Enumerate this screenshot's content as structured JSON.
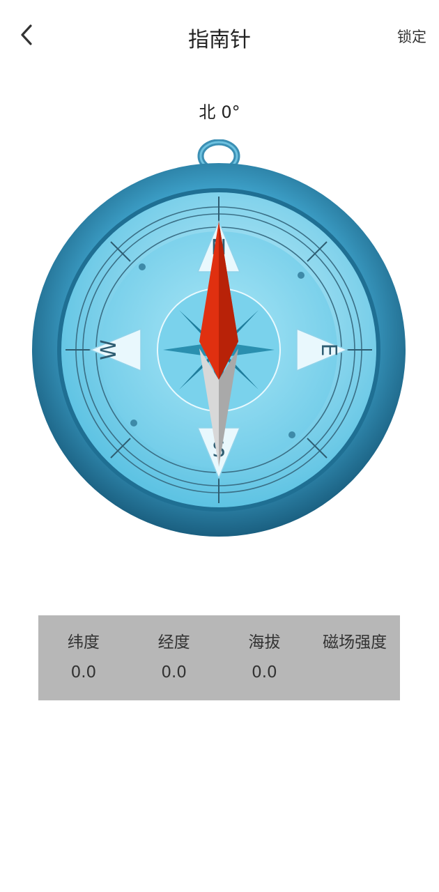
{
  "header": {
    "title": "指南针",
    "lock_label": "锁定"
  },
  "heading": {
    "direction": "北",
    "degrees": "0°"
  },
  "compass": {
    "north_label": "N",
    "south_label": "S",
    "east_label": "E",
    "west_label": "W",
    "colors": {
      "rim_dark": "#1f6f93",
      "rim_light": "#3c9ec6",
      "face": "#7fd3ec",
      "needle_north": "#e03010",
      "needle_south": "#c8c8c8"
    }
  },
  "info": [
    {
      "label": "纬度",
      "value": "0.0"
    },
    {
      "label": "经度",
      "value": "0.0"
    },
    {
      "label": "海拔",
      "value": "0.0"
    },
    {
      "label": "磁场强度",
      "value": ""
    }
  ],
  "icons": {
    "back": "chevron-left-icon"
  }
}
